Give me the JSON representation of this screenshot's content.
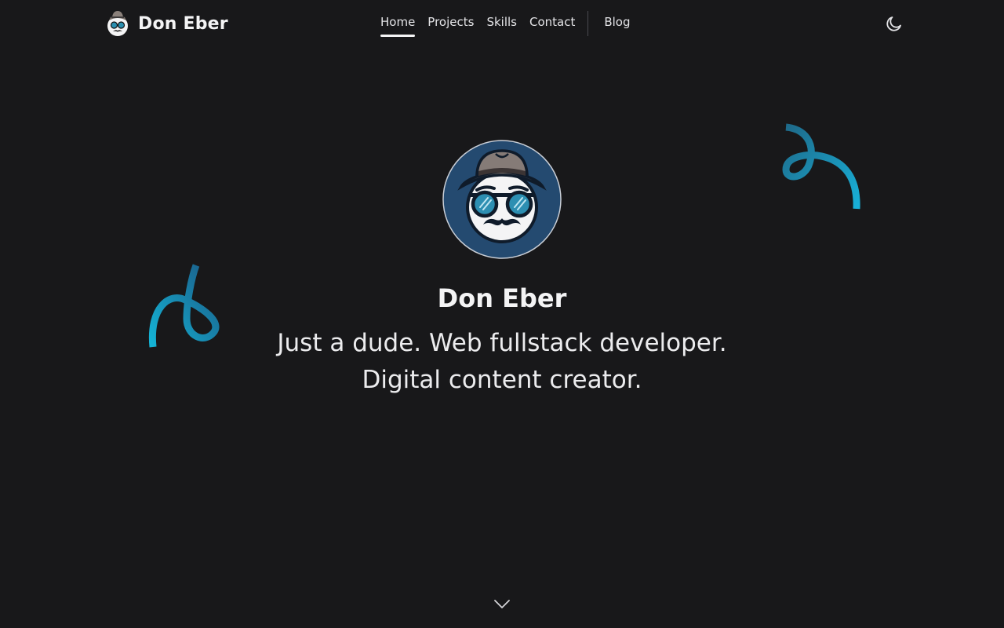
{
  "header": {
    "brand_name": "Don Eber",
    "brand_logo_icon": "hat-glasses-mustache-avatar-icon"
  },
  "nav": {
    "items": [
      {
        "label": "Home",
        "active": true
      },
      {
        "label": "Projects",
        "active": false
      },
      {
        "label": "Skills",
        "active": false
      },
      {
        "label": "Contact",
        "active": false
      },
      {
        "label": "Blog",
        "active": false
      }
    ],
    "theme_toggle_icon": "moon-icon"
  },
  "hero": {
    "avatar_icon": "hat-glasses-mustache-avatar-icon",
    "name": "Don Eber",
    "tagline_line1": "Just a dude. Web fullstack developer.",
    "tagline_line2": "Digital content creator.",
    "scroll_icon": "chevron-down-icon"
  },
  "colors": {
    "background": "#18181a",
    "text": "#f4f4f5",
    "accent_teal": "#14a3c7",
    "accent_dark": "#1f4a78",
    "avatar_bg": "#244a70"
  }
}
